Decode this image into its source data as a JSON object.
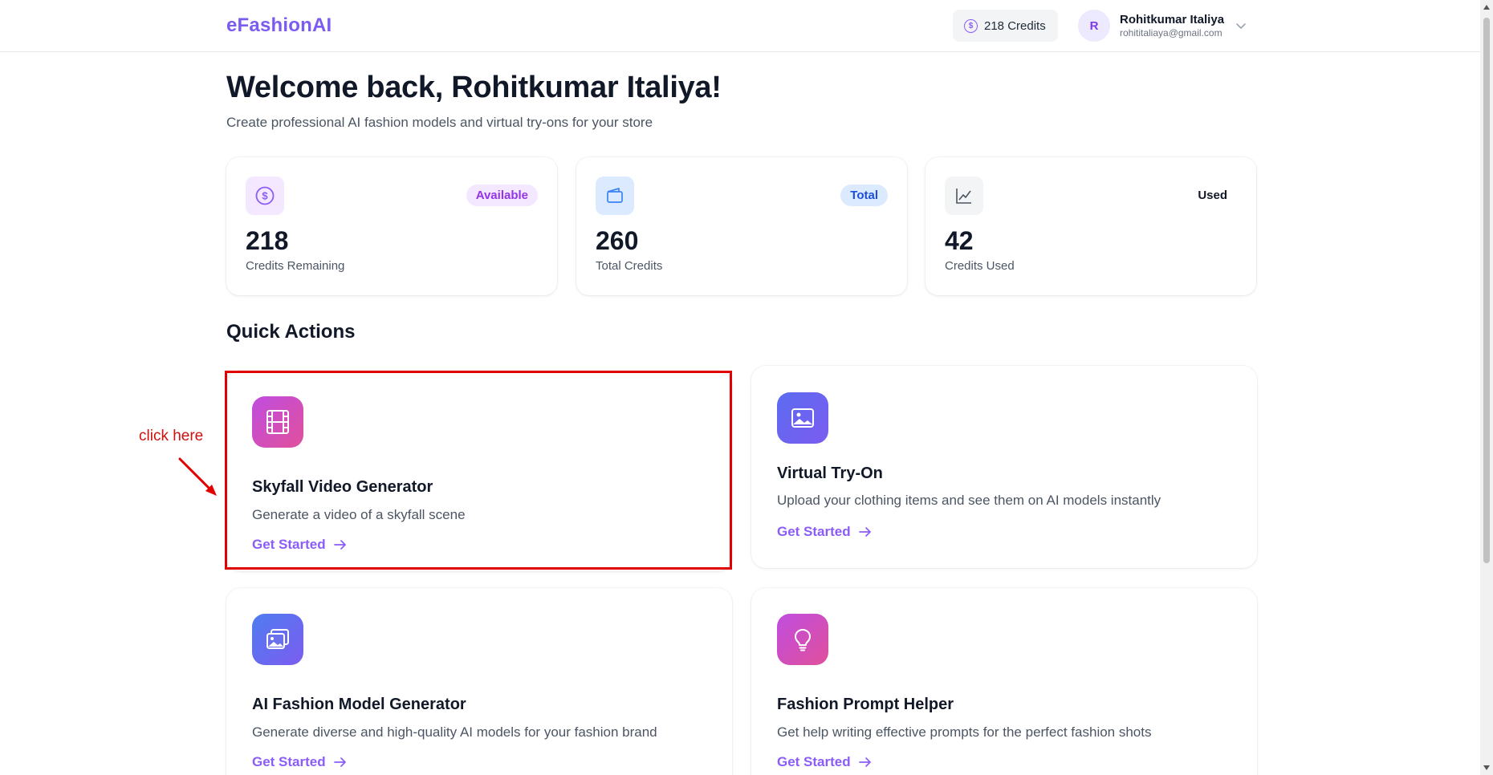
{
  "header": {
    "logo": "eFashionAI",
    "credits_label": "218 Credits",
    "user_initial": "R",
    "user_name": "Rohitkumar Italiya",
    "user_email": "rohititaliaya@gmail.com"
  },
  "welcome": {
    "title": "Welcome back, Rohitkumar Italiya!",
    "subtitle": "Create professional AI fashion models and virtual try-ons for your store"
  },
  "stats": [
    {
      "value": "218",
      "label": "Credits Remaining",
      "badge": "Available",
      "icon": "coin-icon"
    },
    {
      "value": "260",
      "label": "Total Credits",
      "badge": "Total",
      "icon": "wallet-icon"
    },
    {
      "value": "42",
      "label": "Credits Used",
      "badge": "Used",
      "icon": "chart-line-icon"
    }
  ],
  "quick_actions": {
    "title": "Quick Actions",
    "items": [
      {
        "title": "Skyfall Video Generator",
        "description": "Generate a video of a skyfall scene",
        "link": "Get Started",
        "icon": "film-icon"
      },
      {
        "title": "Virtual Try-On",
        "description": "Upload your clothing items and see them on AI models instantly",
        "link": "Get Started",
        "icon": "image-icon"
      },
      {
        "title": "AI Fashion Model Generator",
        "description": "Generate diverse and high-quality AI models for your fashion brand",
        "link": "Get Started",
        "icon": "images-icon"
      },
      {
        "title": "Fashion Prompt Helper",
        "description": "Get help writing effective prompts for the perfect fashion shots",
        "link": "Get Started",
        "icon": "lightbulb-icon"
      }
    ]
  },
  "annotation": {
    "text": "click here"
  },
  "colors": {
    "brand": "#7c5cf0",
    "link": "#8b5cf6",
    "highlight": "#e00000"
  }
}
